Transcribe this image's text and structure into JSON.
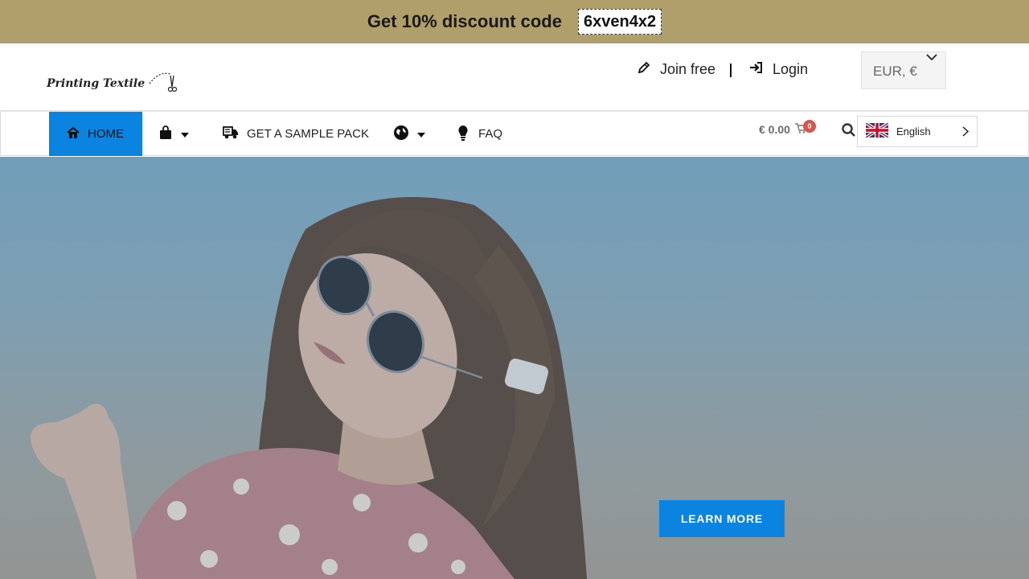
{
  "promo": {
    "text": "Get 10% discount code",
    "code": "6xven4x2"
  },
  "header": {
    "logo_text": "Printing Textile",
    "join_label": "Join free",
    "login_label": "Login",
    "currency": "EUR, €"
  },
  "nav": {
    "home_label": "HOME",
    "sample_label": "GET A SAMPLE PACK",
    "faq_label": "FAQ",
    "cart_total": "€ 0.00",
    "cart_count": "0",
    "language": "English"
  },
  "hero": {
    "button_label": "LEARN MORE"
  },
  "colors": {
    "promo_bg": "#b09f6b",
    "accent": "#0a84e0",
    "badge": "#d9534f"
  },
  "icons": [
    "pencil-icon",
    "sign-in-icon",
    "chevron-down-icon",
    "home-icon",
    "shopping-bag-icon",
    "caret-down-icon",
    "truck-icon",
    "globe-icon",
    "lightbulb-icon",
    "cart-icon",
    "search-icon",
    "uk-flag-icon",
    "chevron-right-icon",
    "scissors-icon"
  ]
}
